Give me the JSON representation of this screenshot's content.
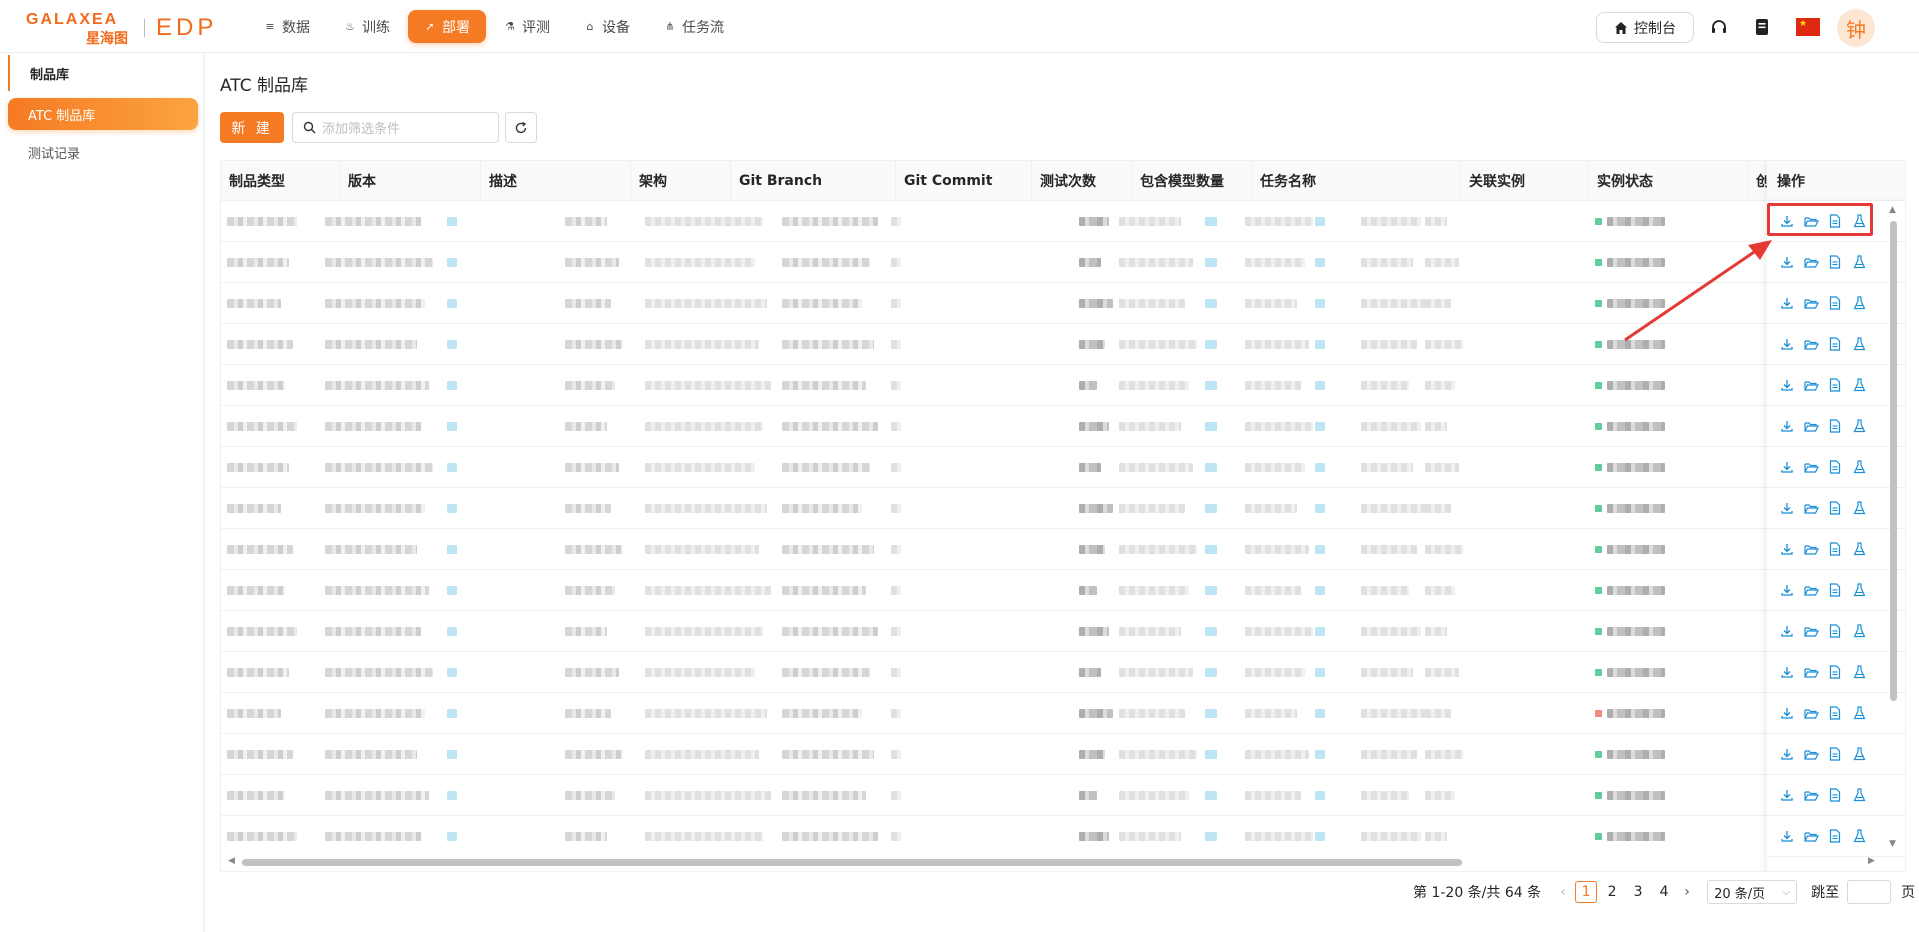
{
  "brand": {
    "name": "GALAXEA",
    "name_cn": "星海图",
    "product": "EDP"
  },
  "nav": {
    "items": [
      {
        "label": "数据",
        "icon": "database-icon",
        "glyph": "≡"
      },
      {
        "label": "训练",
        "icon": "flame-icon",
        "glyph": "♨"
      },
      {
        "label": "部署",
        "icon": "rocket-icon",
        "glyph": "➚"
      },
      {
        "label": "评测",
        "icon": "flask-icon",
        "glyph": "⚗"
      },
      {
        "label": "设备",
        "icon": "robot-icon",
        "glyph": "⌂"
      },
      {
        "label": "任务流",
        "icon": "flow-icon",
        "glyph": "⋔"
      }
    ],
    "active_index": 2
  },
  "header": {
    "console_label": "控制台",
    "avatar_text": "钟"
  },
  "sidebar": {
    "group_label": "制品库",
    "items": [
      {
        "label": "ATC 制品库",
        "active": true
      },
      {
        "label": "测试记录",
        "active": false
      }
    ]
  },
  "main": {
    "title": "ATC 制品库",
    "new_label": "新 建",
    "filter_placeholder": "添加筛选条件"
  },
  "table": {
    "columns": [
      "制品类型",
      "版本",
      "描述",
      "架构",
      "Git Branch",
      "Git Commit",
      "测试次数",
      "包含模型数量",
      "任务名称",
      "关联实例",
      "实例状态",
      "创"
    ],
    "ops_header": "操作",
    "ops_icons": [
      "download-icon",
      "folder-open-icon",
      "file-icon",
      "flask-icon"
    ],
    "row_count": 16,
    "status_colors": [
      "#5ccf9a",
      "#5ccf9a",
      "#5ccf9a",
      "#5ccf9a",
      "#5ccf9a",
      "#5ccf9a",
      "#5ccf9a",
      "#5ccf9a",
      "#5ccf9a",
      "#5ccf9a",
      "#5ccf9a",
      "#5ccf9a",
      "#f08a7e",
      "#5ccf9a",
      "#5ccf9a",
      "#5ccf9a"
    ]
  },
  "pagination": {
    "summary": "第 1-20 条/共 64 条",
    "pages": [
      "1",
      "2",
      "3",
      "4"
    ],
    "current": "1",
    "page_size": "20 条/页",
    "jump_label": "跳至",
    "page_suffix": "页"
  },
  "colors": {
    "accent": "#f57a24",
    "link": "#1a8fd8",
    "highlight": "#e53935"
  }
}
